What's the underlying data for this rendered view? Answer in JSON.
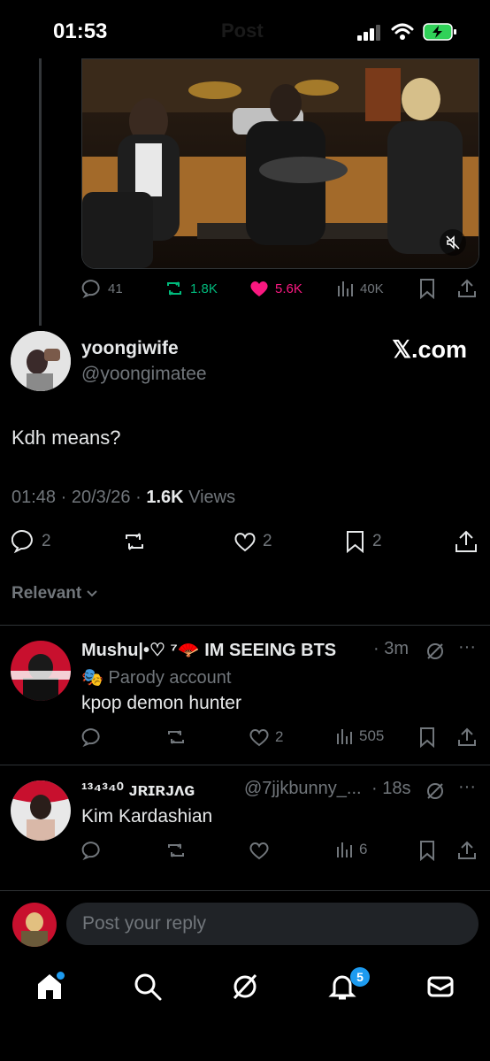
{
  "status": {
    "time": "01:53",
    "ghost_title": "Post"
  },
  "colors": {
    "accent": "#1d9bf0",
    "like": "#f91880",
    "retweet": "#00ba7c",
    "muted": "#71767b",
    "text": "#e7e9ea"
  },
  "quoted_actions": {
    "replies": "41",
    "reposts": "1.8K",
    "likes": "5.6K",
    "views": "40K"
  },
  "author": {
    "name": "yoongiwife",
    "handle": "@yoongimatee",
    "source_label": "𝕏.com"
  },
  "tweet": {
    "text": "Kdh means?",
    "time": "01:48 · 20/3/26 · ",
    "views_count": "1.6K",
    "views_label": " Views"
  },
  "tweet_actions": {
    "replies": "2",
    "likes": "2",
    "bookmarks": "2"
  },
  "sort": {
    "label": "Relevant"
  },
  "replies": [
    {
      "name": "Mushu|•♡ ⁷🪭 IM SEEING BTS",
      "age": "· 3m",
      "badge": "🎭 Parody account",
      "text": "kpop demon hunter",
      "likes": "2",
      "views": "505"
    },
    {
      "name": "¹³⁴³⁴⁰ ᴊʀɪʀᴊᴧɢ",
      "handle": "@7jjkbunny_...",
      "age": "· 18s",
      "text": "Kim Kardashian",
      "views": "6"
    }
  ],
  "composer": {
    "placeholder": "Post your reply"
  },
  "nav": {
    "notifications_badge": "5"
  }
}
